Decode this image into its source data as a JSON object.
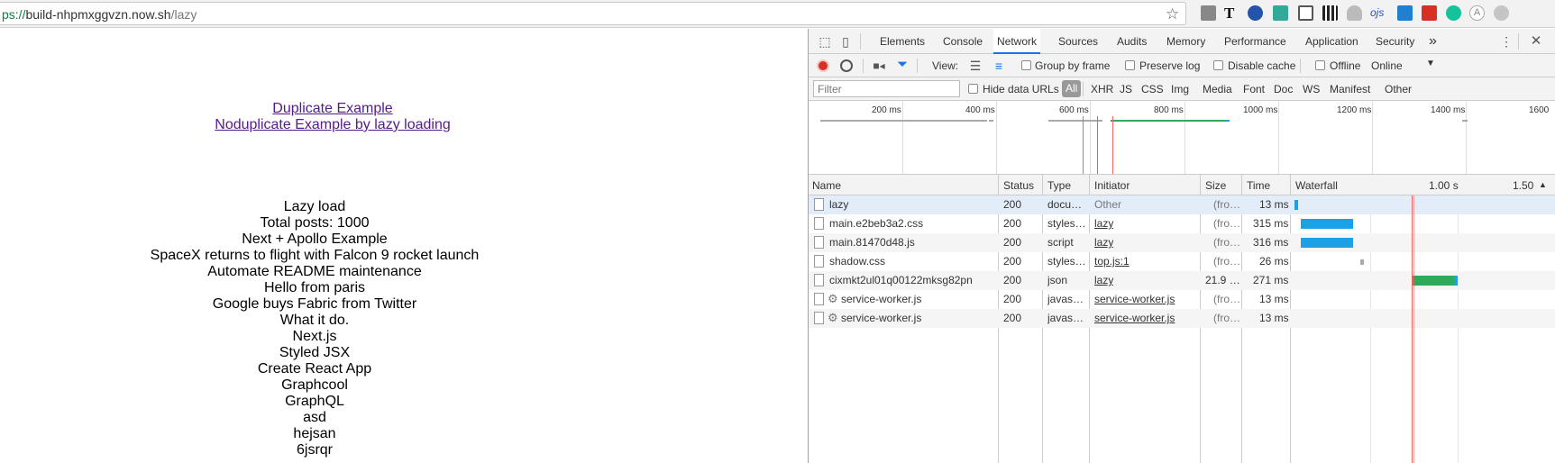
{
  "browser": {
    "url_scheme": "ps://",
    "url_host": "build-nhpmxggvzn.now.sh",
    "url_path": "/lazy",
    "star_icon": "star-icon"
  },
  "page": {
    "links": [
      "Duplicate Example",
      "Noduplicate Example by lazy loading"
    ],
    "posts": [
      "Lazy load",
      "Total posts: 1000",
      "Next + Apollo Example",
      "SpaceX returns to flight with Falcon 9 rocket launch",
      "Automate README maintenance",
      "Hello from paris",
      "Google buys Fabric from Twitter",
      "What it do.",
      "Next.js",
      "Styled JSX",
      "Create React App",
      "Graphcool",
      "GraphQL",
      "asd",
      "hejsan",
      "6jsrqr"
    ]
  },
  "devtools": {
    "tabs": [
      "Elements",
      "Console",
      "Network",
      "Sources",
      "Audits",
      "Memory",
      "Performance",
      "Application",
      "Security"
    ],
    "active_tab": "Network",
    "more_tabs": "»",
    "toolbar": {
      "view_label": "View:",
      "group_by_frame": "Group by frame",
      "preserve_log": "Preserve log",
      "disable_cache": "Disable cache",
      "offline": "Offline",
      "throttle": "Online"
    },
    "filter": {
      "placeholder": "Filter",
      "hide_data_urls": "Hide data URLs",
      "types": [
        "All",
        "XHR",
        "JS",
        "CSS",
        "Img",
        "Media",
        "Font",
        "Doc",
        "WS",
        "Manifest",
        "Other"
      ],
      "active_type": "All"
    },
    "overview_ticks": [
      "200 ms",
      "400 ms",
      "600 ms",
      "800 ms",
      "1000 ms",
      "1200 ms",
      "1400 ms",
      "1600"
    ],
    "columns": [
      "Name",
      "Status",
      "Type",
      "Initiator",
      "Size",
      "Time",
      "Waterfall"
    ],
    "waterfall_ticks": [
      "1.00 s",
      "1.50"
    ],
    "requests": [
      {
        "name": "lazy",
        "status": "200",
        "type": "docu…",
        "initiator": "Other",
        "size": "(fro…",
        "time": "13 ms"
      },
      {
        "name": "main.e2beb3a2.css",
        "status": "200",
        "type": "styles…",
        "initiator": "lazy",
        "size": "(fro…",
        "time": "315 ms"
      },
      {
        "name": "main.81470d48.js",
        "status": "200",
        "type": "script",
        "initiator": "lazy",
        "size": "(fro…",
        "time": "316 ms"
      },
      {
        "name": "shadow.css",
        "status": "200",
        "type": "styles…",
        "initiator": "top.js:1",
        "size": "(fro…",
        "time": "26 ms"
      },
      {
        "name": "cixmkt2ul01q00122mksg82pn",
        "status": "200",
        "type": "json",
        "initiator": "lazy",
        "size": "21.9 …",
        "time": "271 ms"
      },
      {
        "name": "service-worker.js",
        "status": "200",
        "type": "javas…",
        "initiator": "service-worker.js",
        "size": "(fro…",
        "time": "13 ms"
      },
      {
        "name": "service-worker.js",
        "status": "200",
        "type": "javas…",
        "initiator": "service-worker.js",
        "size": "(fro…",
        "time": "13 ms"
      }
    ],
    "colors": {
      "accent": "#1a73e8",
      "record": "#d93025",
      "waiting": "#2eab5a",
      "receiving": "#1da1e6",
      "filter": "#1a73e8"
    }
  }
}
